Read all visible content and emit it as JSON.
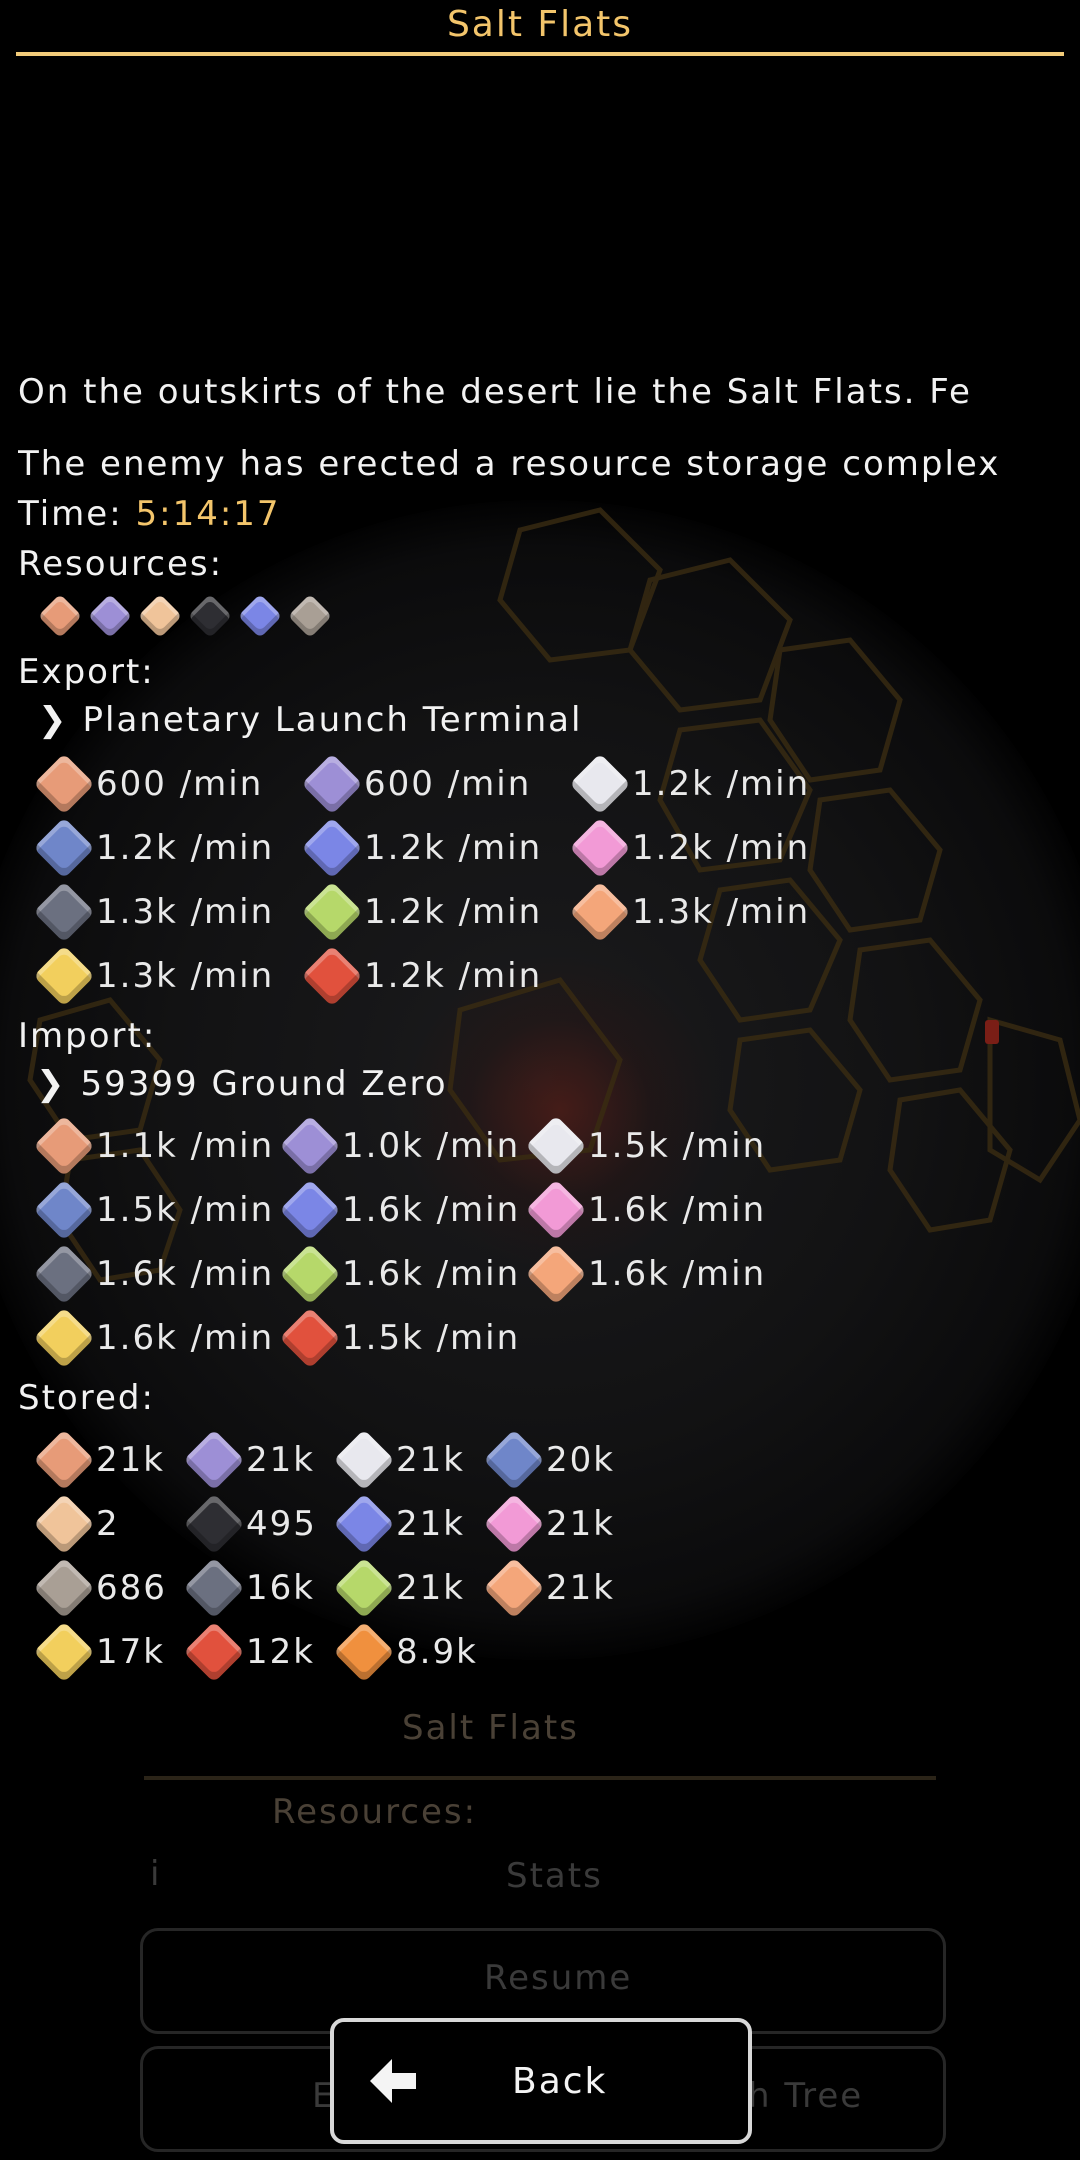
{
  "header": {
    "title": "Salt Flats"
  },
  "description": {
    "line1": "On the outskirts of the desert lie the Salt Flats. Fe",
    "line2": "The enemy has erected a resource storage complex"
  },
  "time": {
    "label": "Time: ",
    "value": "5:14:17"
  },
  "resources": {
    "label": "Resources:",
    "icons": [
      "copper-ore-icon",
      "amethyst-icon",
      "sand-icon",
      "coal-icon",
      "sapphire-icon",
      "scrap-icon"
    ]
  },
  "export": {
    "label": "Export:",
    "target": "Planetary Launch Terminal",
    "rates": [
      {
        "icon": "copper-bar-icon",
        "value": "600 /min"
      },
      {
        "icon": "purple-bar-icon",
        "value": "600 /min"
      },
      {
        "icon": "silver-bar-icon",
        "value": "1.2k /min"
      },
      {
        "icon": "blue-plate-icon",
        "value": "1.2k /min"
      },
      {
        "icon": "blue-crystal-icon",
        "value": "1.2k /min"
      },
      {
        "icon": "pink-heart-icon",
        "value": "1.2k /min"
      },
      {
        "icon": "gray-stone-icon",
        "value": "1.3k /min"
      },
      {
        "icon": "green-gem-icon",
        "value": "1.2k /min"
      },
      {
        "icon": "orange-stripe-icon",
        "value": "1.3k /min"
      },
      {
        "icon": "gold-bar-icon",
        "value": "1.3k /min"
      },
      {
        "icon": "red-core-icon",
        "value": "1.2k /min"
      }
    ]
  },
  "import": {
    "label": "Import:",
    "source": "59399 Ground Zero",
    "rates": [
      {
        "icon": "copper-bar-icon",
        "value": "1.1k /min"
      },
      {
        "icon": "purple-bar-icon",
        "value": "1.0k /min"
      },
      {
        "icon": "silver-bar-icon",
        "value": "1.5k /min"
      },
      {
        "icon": "blue-plate-icon",
        "value": "1.5k /min"
      },
      {
        "icon": "blue-crystal-icon",
        "value": "1.6k /min"
      },
      {
        "icon": "pink-heart-icon",
        "value": "1.6k /min"
      },
      {
        "icon": "gray-stone-icon",
        "value": "1.6k /min"
      },
      {
        "icon": "green-gem-icon",
        "value": "1.6k /min"
      },
      {
        "icon": "orange-stripe-icon",
        "value": "1.6k /min"
      },
      {
        "icon": "gold-bar-icon",
        "value": "1.6k /min"
      },
      {
        "icon": "red-core-icon",
        "value": "1.5k /min"
      }
    ]
  },
  "stored": {
    "label": "Stored:",
    "items": [
      {
        "icon": "copper-bar-icon",
        "value": "21k"
      },
      {
        "icon": "purple-bar-icon",
        "value": "21k"
      },
      {
        "icon": "silver-bar-icon",
        "value": "21k"
      },
      {
        "icon": "blue-plate-icon",
        "value": "20k"
      },
      {
        "icon": "sand-chip-icon",
        "value": "2"
      },
      {
        "icon": "coal-icon",
        "value": "495"
      },
      {
        "icon": "blue-crystal-icon",
        "value": "21k"
      },
      {
        "icon": "pink-heart-icon",
        "value": "21k"
      },
      {
        "icon": "scrap-icon",
        "value": "686"
      },
      {
        "icon": "gray-stone-icon",
        "value": "16k"
      },
      {
        "icon": "green-gem-icon",
        "value": "21k"
      },
      {
        "icon": "orange-stripe-icon",
        "value": "21k"
      },
      {
        "icon": "gold-bar-icon",
        "value": "17k"
      },
      {
        "icon": "red-core-icon",
        "value": "12k"
      },
      {
        "icon": "orange-core-icon",
        "value": "8.9k"
      }
    ]
  },
  "underlay": {
    "title": "Salt Flats",
    "resources_label": "Resources:",
    "stats_label": "Stats",
    "resume_label": "Resume",
    "left_fragment": "E",
    "right_fragment": "h Tree"
  },
  "back_button": {
    "label": "Back"
  },
  "colors": {
    "accent": "#f3c56b",
    "copper-bar-icon": "#e79b78",
    "purple-bar-icon": "#9d8fd6",
    "silver-bar-icon": "#e8e8ee",
    "blue-plate-icon": "#6f86c9",
    "blue-crystal-icon": "#7b86e6",
    "pink-heart-icon": "#f29ad6",
    "gray-stone-icon": "#6b7080",
    "green-gem-icon": "#b6d86a",
    "orange-stripe-icon": "#f4a67a",
    "gold-bar-icon": "#f2cf5d",
    "red-core-icon": "#e1513d",
    "orange-core-icon": "#f0903e",
    "copper-ore-icon": "#e79b78",
    "amethyst-icon": "#9d8fd6",
    "sand-icon": "#f0c49a",
    "coal-icon": "#2e2e33",
    "sapphire-icon": "#7b86e6",
    "scrap-icon": "#a99f95",
    "sand-chip-icon": "#f0c49a"
  }
}
